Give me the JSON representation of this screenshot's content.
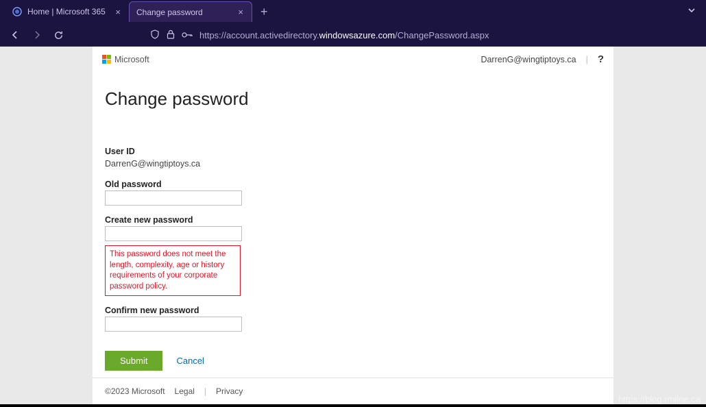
{
  "browser": {
    "tabs": [
      {
        "title": "Home | Microsoft 365",
        "active": false
      },
      {
        "title": "Change password",
        "active": true
      }
    ],
    "url_prefix": "https://account.activedirectory.",
    "url_host": "windowsazure.com",
    "url_path": "/ChangePassword.aspx"
  },
  "header": {
    "brand": "Microsoft",
    "user_email": "DarrenG@wingtiptoys.ca",
    "help": "?"
  },
  "page": {
    "title": "Change password",
    "user_id_label": "User ID",
    "user_id_value": "DarrenG@wingtiptoys.ca",
    "old_pw_label": "Old password",
    "new_pw_label": "Create new password",
    "confirm_pw_label": "Confirm new password",
    "error_text": "This password does not meet the length, complexity, age or history requirements of your corporate password policy.",
    "submit_label": "Submit",
    "cancel_label": "Cancel"
  },
  "footer": {
    "copyright": "©2023 Microsoft",
    "legal": "Legal",
    "privacy": "Privacy"
  },
  "watermark": "https://blog.rmilne.ca"
}
